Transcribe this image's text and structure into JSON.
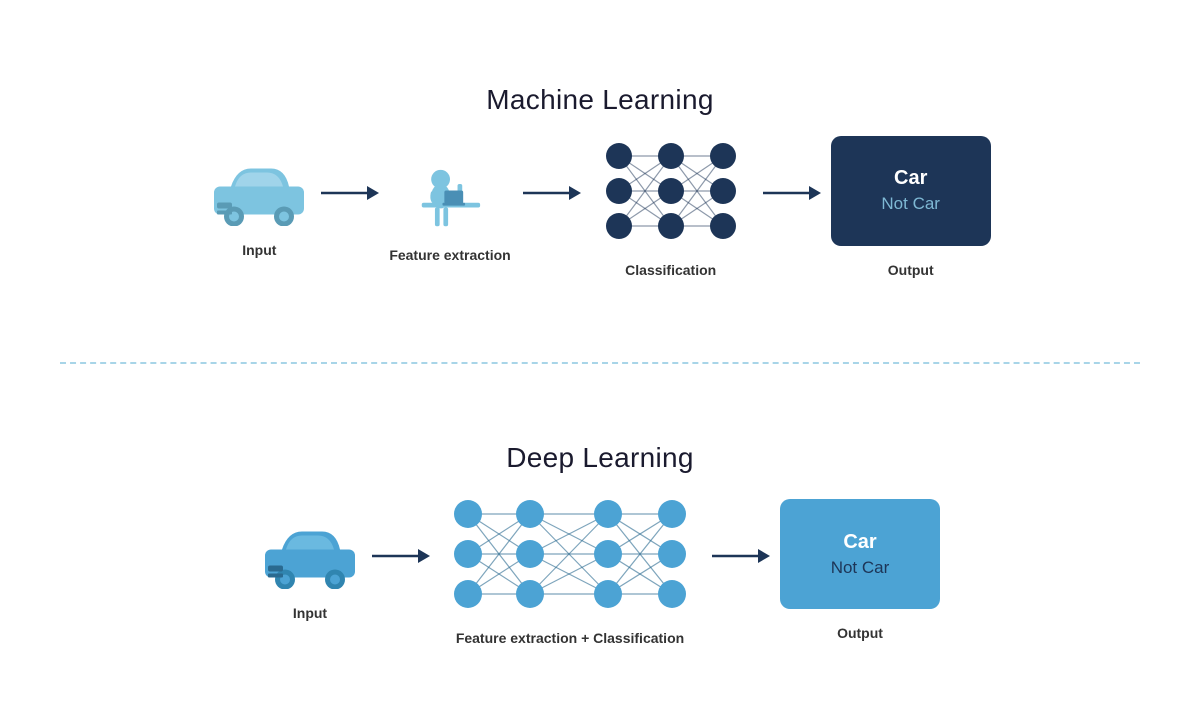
{
  "machine_learning": {
    "title": "Machine Learning",
    "input_label": "Input",
    "feature_label": "Feature extraction",
    "classification_label": "Classification",
    "output_label": "Output",
    "output_car": "Car",
    "output_notcar": "Not Car"
  },
  "deep_learning": {
    "title": "Deep Learning",
    "input_label": "Input",
    "feature_class_label": "Feature extraction + Classification",
    "output_label": "Output",
    "output_car": "Car",
    "output_notcar": "Not Car"
  },
  "colors": {
    "ml_car_icon": "#7dc4e0",
    "dl_car_icon": "#4ca3d4",
    "nn_ml_node": "#1d3557",
    "nn_dl_node": "#4ca3d4",
    "arrow_color": "#1d3557",
    "divider_color": "#a8d5e8",
    "output_ml_bg": "#1d3557",
    "output_dl_bg": "#4ca3d4"
  }
}
